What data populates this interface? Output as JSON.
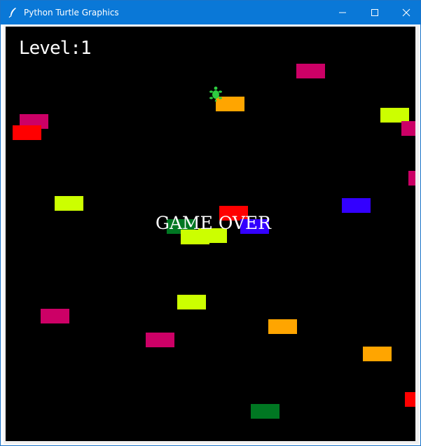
{
  "window": {
    "title": "Python Turtle Graphics",
    "icon": "feather-icon",
    "controls": [
      "minimize-icon",
      "maximize-icon",
      "close-icon"
    ],
    "titlebar_color": "#0a78d7"
  },
  "game": {
    "level_text": "Level:1",
    "status_text": "GAME OVER",
    "background": "#000000",
    "player": {
      "shape": "turtle",
      "color": "#2ecc40"
    },
    "car_colors": {
      "red": "#ff0000",
      "magenta": "#cc0066",
      "yellow_green": "#ccff00",
      "orange": "#ffa500",
      "blue": "#3300ff",
      "green": "#007722"
    },
    "cars": [
      {
        "color": "magenta"
      },
      {
        "color": "orange"
      },
      {
        "color": "yellow_green"
      },
      {
        "color": "magenta"
      },
      {
        "color": "red"
      },
      {
        "color": "magenta"
      },
      {
        "color": "magenta"
      },
      {
        "color": "yellow_green"
      },
      {
        "color": "blue"
      },
      {
        "color": "red"
      },
      {
        "color": "green"
      },
      {
        "color": "yellow_green"
      },
      {
        "color": "yellow_green"
      },
      {
        "color": "blue"
      },
      {
        "color": "yellow_green"
      },
      {
        "color": "magenta"
      },
      {
        "color": "orange"
      },
      {
        "color": "magenta"
      },
      {
        "color": "orange"
      },
      {
        "color": "red"
      },
      {
        "color": "green"
      }
    ]
  }
}
